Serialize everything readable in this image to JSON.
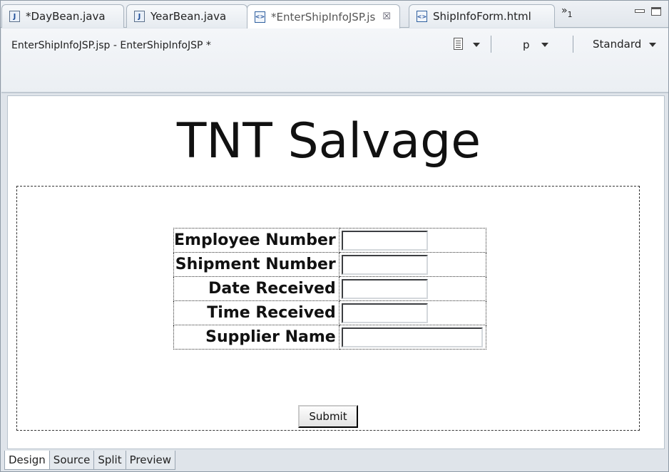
{
  "tabs": [
    {
      "label": "*DayBean.java",
      "icon": "java-file-icon",
      "active": false
    },
    {
      "label": "YearBean.java",
      "icon": "java-file-icon",
      "active": false
    },
    {
      "label": "*EnterShipInfoJSP.js",
      "icon": "jsp-file-icon",
      "active": true,
      "close": "☒"
    },
    {
      "label": "ShipInfoForm.html",
      "icon": "html-file-icon",
      "active": false
    }
  ],
  "overflow": {
    "symbol": "»",
    "count": "1"
  },
  "header": {
    "file_title": "EnterShipInfoJSP.jsp - EnterShipInfoJSP *",
    "element_select": "p",
    "device_select": "Standard"
  },
  "page": {
    "heading": "TNT Salvage",
    "fields": [
      {
        "label": "Employee Number",
        "value": ""
      },
      {
        "label": "Shipment Number",
        "value": ""
      },
      {
        "label": "Date Received",
        "value": ""
      },
      {
        "label": "Time Received",
        "value": ""
      },
      {
        "label": "Supplier Name",
        "value": ""
      }
    ],
    "submit_label": "Submit"
  },
  "view_tabs": [
    {
      "label": "Design",
      "active": true
    },
    {
      "label": "Source",
      "active": false
    },
    {
      "label": "Split",
      "active": false
    },
    {
      "label": "Preview",
      "active": false
    }
  ]
}
